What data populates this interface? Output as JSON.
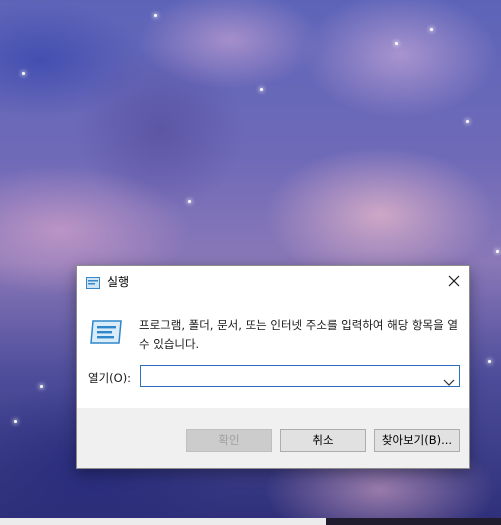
{
  "dialog": {
    "title": "실행",
    "description": "프로그램, 폴더, 문서, 또는 인터넷 주소를 입력하여 해당 항목을 열 수 있습니다.",
    "open_label": "열기(O):",
    "open_value": "",
    "buttons": {
      "ok": "확인",
      "cancel": "취소",
      "browse": "찾아보기(B)..."
    },
    "ok_enabled": false,
    "icons": {
      "title": "run-icon",
      "content": "run-app-icon",
      "close": "close-icon",
      "dropdown": "chevron-down-icon"
    }
  },
  "colors": {
    "accent_border": "#2c6fbf",
    "footer_bg": "#f0f0f0",
    "button_bg": "#e1e1e1"
  }
}
